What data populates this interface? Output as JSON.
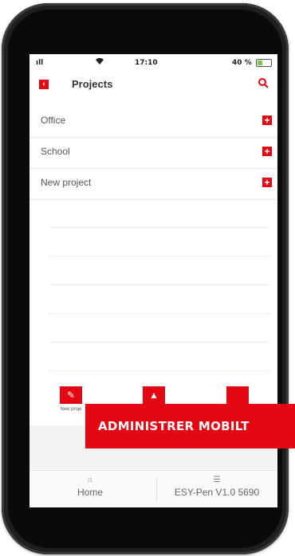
{
  "status": {
    "signal": "ıll",
    "time": "17:10",
    "battery": "40 %",
    "battery_level": 0.4,
    "battery_color": "#7ac943"
  },
  "header": {
    "back_icon": "back-arrow-icon",
    "title": "Projects",
    "search_icon": "search-icon"
  },
  "projects": [
    {
      "label": "Office",
      "action_icon": "add-icon"
    },
    {
      "label": "School",
      "action_icon": "add-icon"
    },
    {
      "label": "New project",
      "action_icon": "add-icon"
    }
  ],
  "toolbar": {
    "new_project_label": "New proje",
    "edit_icon": "edit-icon"
  },
  "tabs": [
    {
      "label": "Home",
      "icon": "home-icon"
    },
    {
      "label": "ESY-Pen V1.0 5690",
      "icon": "settings-sliders-icon"
    }
  ],
  "banner": {
    "text": "ADMINISTRER MOBILT"
  },
  "colors": {
    "accent": "#e30613"
  }
}
